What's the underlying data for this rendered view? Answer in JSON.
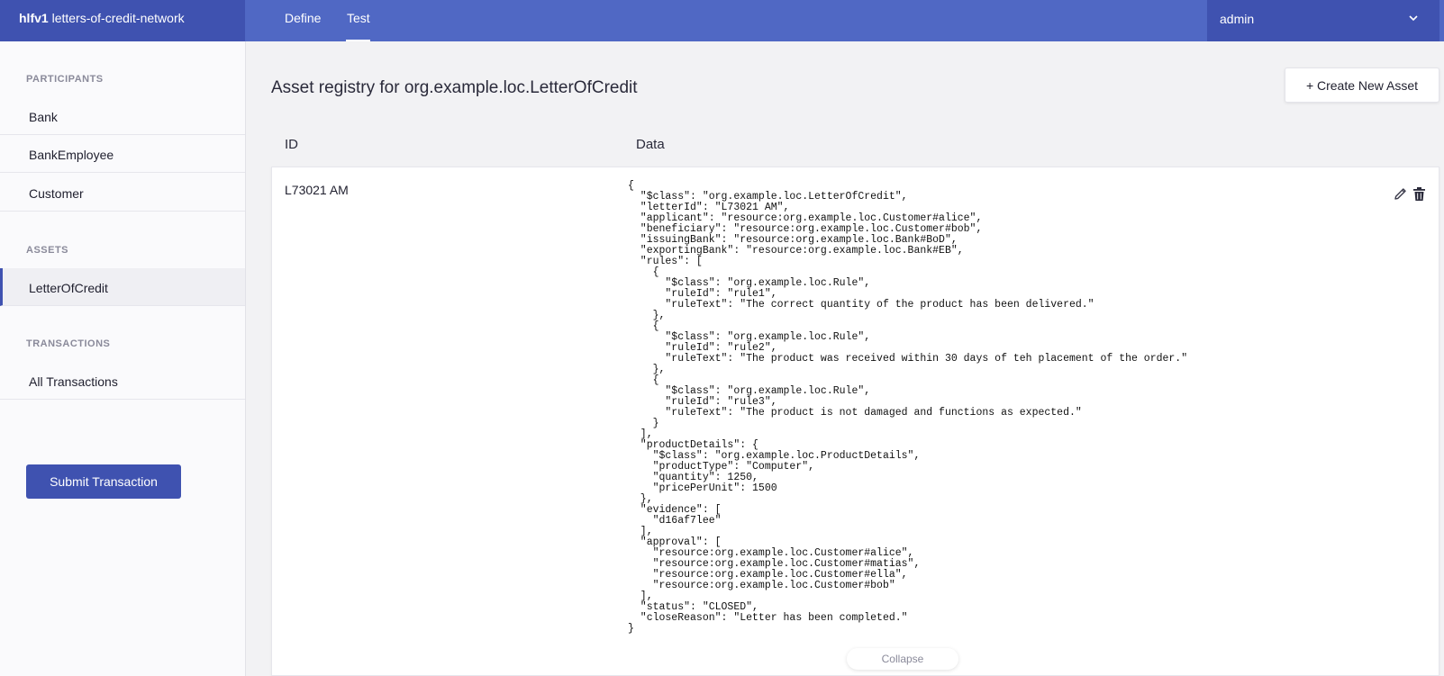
{
  "header": {
    "brand_bold": "hlfv1",
    "brand_name": "letters-of-credit-network",
    "tabs": [
      {
        "label": "Define"
      },
      {
        "label": "Test"
      }
    ],
    "user": "admin"
  },
  "sidebar": {
    "participants_heading": "PARTICIPANTS",
    "participants": [
      {
        "label": "Bank"
      },
      {
        "label": "BankEmployee"
      },
      {
        "label": "Customer"
      }
    ],
    "assets_heading": "ASSETS",
    "assets": [
      {
        "label": "LetterOfCredit"
      }
    ],
    "transactions_heading": "TRANSACTIONS",
    "transactions": [
      {
        "label": "All Transactions"
      }
    ],
    "submit_label": "Submit Transaction"
  },
  "main": {
    "title": "Asset registry for org.example.loc.LetterOfCredit",
    "create_label": "+ Create New Asset",
    "col_id": "ID",
    "col_data": "Data",
    "row": {
      "id": "L73021 AM",
      "data": "{\n  \"$class\": \"org.example.loc.LetterOfCredit\",\n  \"letterId\": \"L73021 AM\",\n  \"applicant\": \"resource:org.example.loc.Customer#alice\",\n  \"beneficiary\": \"resource:org.example.loc.Customer#bob\",\n  \"issuingBank\": \"resource:org.example.loc.Bank#BoD\",\n  \"exportingBank\": \"resource:org.example.loc.Bank#EB\",\n  \"rules\": [\n    {\n      \"$class\": \"org.example.loc.Rule\",\n      \"ruleId\": \"rule1\",\n      \"ruleText\": \"The correct quantity of the product has been delivered.\"\n    },\n    {\n      \"$class\": \"org.example.loc.Rule\",\n      \"ruleId\": \"rule2\",\n      \"ruleText\": \"The product was received within 30 days of teh placement of the order.\"\n    },\n    {\n      \"$class\": \"org.example.loc.Rule\",\n      \"ruleId\": \"rule3\",\n      \"ruleText\": \"The product is not damaged and functions as expected.\"\n    }\n  ],\n  \"productDetails\": {\n    \"$class\": \"org.example.loc.ProductDetails\",\n    \"productType\": \"Computer\",\n    \"quantity\": 1250,\n    \"pricePerUnit\": 1500\n  },\n  \"evidence\": [\n    \"d16af7lee\"\n  ],\n  \"approval\": [\n    \"resource:org.example.loc.Customer#alice\",\n    \"resource:org.example.loc.Customer#matias\",\n    \"resource:org.example.loc.Customer#ella\",\n    \"resource:org.example.loc.Customer#bob\"\n  ],\n  \"status\": \"CLOSED\",\n  \"closeReason\": \"Letter has been completed.\"\n}"
    },
    "collapse_label": "Collapse"
  },
  "icons": {
    "edit": "pencil-icon",
    "delete": "trash-icon",
    "user_menu": "chevron-down-icon"
  },
  "colors": {
    "header": "#5068c4",
    "header_dark": "#3f52b0",
    "primary_button": "#3f52b0"
  }
}
